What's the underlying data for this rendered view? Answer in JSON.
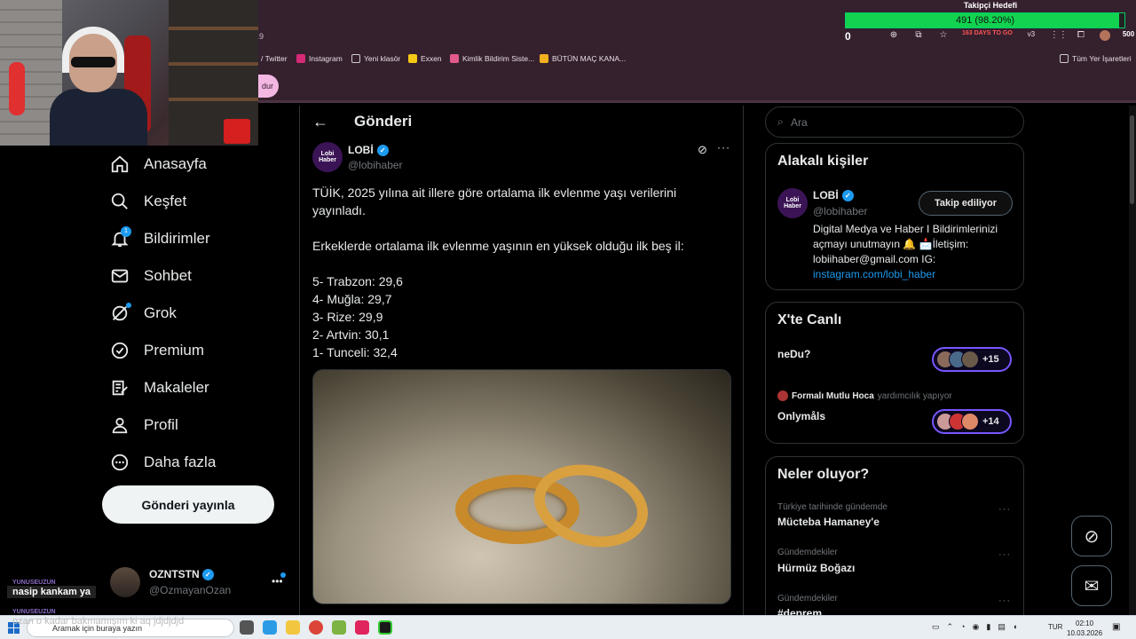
{
  "stream_overlay": {
    "follower_goal_title": "Takipçi Hedefi",
    "follower_goal_text": "491 (98.20%)",
    "follower_goal_fraction": 0.982,
    "follower_count_left": "0",
    "follower_count_right": "500",
    "chat": [
      {
        "user": "YUNUSEUZUN",
        "message": "nasip kankam ya"
      },
      {
        "user": "YUNUSEUZUN",
        "message": "ozan o kadar bakmamışım ki aq jdjdjdjd"
      }
    ]
  },
  "browser": {
    "tab_fragment": "19",
    "pink_button_label": "dur",
    "bookmarks": [
      {
        "label": "/ Twitter",
        "color": "#9aa0a6"
      },
      {
        "label": "Instagram",
        "color": "#d62976"
      },
      {
        "label": "Yeni klasör",
        "color": "#cccccc"
      },
      {
        "label": "Exxen",
        "color": "#f6c915"
      },
      {
        "label": "Kimlik Bildirim Siste...",
        "color": "#e05a8a"
      },
      {
        "label": "BÜTÜN MAÇ KANA...",
        "color": "#f2b01e"
      }
    ],
    "all_bookmarks": "Tüm Yer İşaretleri",
    "toolbar_badge": "163 DAYS TO GO",
    "toolbar_v3": "v3"
  },
  "nav": {
    "items": [
      {
        "label": "Anasayfa",
        "icon": "home-icon"
      },
      {
        "label": "Keşfet",
        "icon": "search-icon"
      },
      {
        "label": "Bildirimler",
        "icon": "bell-icon",
        "badge": "1"
      },
      {
        "label": "Sohbet",
        "icon": "mail-icon"
      },
      {
        "label": "Grok",
        "icon": "grok-icon"
      },
      {
        "label": "Premium",
        "icon": "premium-icon"
      },
      {
        "label": "Makaleler",
        "icon": "articles-icon"
      },
      {
        "label": "Profil",
        "icon": "profile-icon"
      },
      {
        "label": "Daha fazla",
        "icon": "more-icon"
      }
    ],
    "post_button": "Gönderi yayınla",
    "account": {
      "name": "OZNTSTN",
      "handle": "@OzmayanOzan"
    }
  },
  "post": {
    "page_title": "Gönderi",
    "author_name": "LOBİ",
    "author_handle": "@lobihaber",
    "avatar_text": "Lobi Haber",
    "paragraph1": "TÜİK, 2025 yılına ait illere göre ortalama ilk evlenme yaşı verilerini yayınladı.",
    "paragraph2": "Erkeklerde ortalama ilk evlenme yaşının en yüksek olduğu ilk beş il:",
    "list": [
      "5- Trabzon: 29,6",
      "4- Muğla: 29,7",
      "3- Rize: 29,9",
      "2- Artvin: 30,1",
      "1- Tunceli: 32,4"
    ]
  },
  "right": {
    "search_placeholder": "Ara",
    "related": {
      "title": "Alakalı kişiler",
      "name": "LOBİ",
      "handle": "@lobihaber",
      "follow_label": "Takip ediliyor",
      "bio": "Digital Medya ve Haber I Bildirimlerinizi açmayı unutmayın 🔔 📩İletişim: lobiihaber@gmail.com IG: ",
      "bio_link": "instagram.com/lobi_haber"
    },
    "live": {
      "title": "X'te Canlı",
      "space1_title": "neDu?",
      "space1_count": "+15",
      "space2_host": "Formalı Mutlu Hoca",
      "space2_host_suffix": "yardımcılık yapıyor",
      "space2_title": "Onlymåls",
      "space2_count": "+14"
    },
    "trends": {
      "title": "Neler oluyor?",
      "items": [
        {
          "category": "Türkiye tarihinde gündemde",
          "name": "Mücteba Hamaney'e"
        },
        {
          "category": "Gündemdekiler",
          "name": "Hürmüz Boğazı"
        },
        {
          "category": "Gündemdekiler",
          "name": "#deprem"
        }
      ]
    }
  },
  "taskbar": {
    "search_placeholder": "Aramak için buraya yazın",
    "language": "TUR",
    "time": "02:10",
    "date": "10.03.2026"
  }
}
